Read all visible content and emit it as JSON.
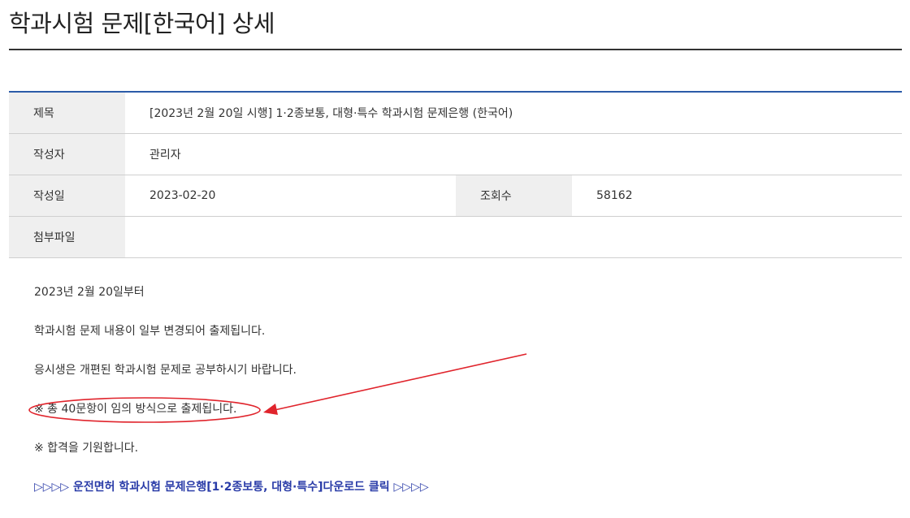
{
  "page": {
    "title": "학과시험 문제[한국어] 상세"
  },
  "info": {
    "subject_label": "제목",
    "subject_value": "[2023년 2월 20일 시행] 1·2종보통, 대형·특수 학과시험 문제은행 (한국어)",
    "author_label": "작성자",
    "author_value": "관리자",
    "date_label": "작성일",
    "date_value": "2023-02-20",
    "views_label": "조회수",
    "views_value": "58162",
    "attachment_label": "첨부파일",
    "attachment_value": ""
  },
  "content": {
    "lines": [
      "2023년 2월 20일부터",
      "학과시험 문제 내용이 일부 변경되어 출제됩니다.",
      "응시생은 개편된 학과시험 문제로 공부하시기 바랍니다.",
      "※ 총 40문항이 임의 방식으로 출제됩니다.",
      "※ 합격을 기원합니다."
    ],
    "download_link": "▷▷▷▷ 운전면허 학과시험 문제은행[1·2종보통, 대형·특수]다운로드 클릭 ▷▷▷▷"
  },
  "colors": {
    "header_border": "#2b5ba8",
    "label_bg": "#efefef",
    "link": "#2a3ca8",
    "annotation": "#e0242c"
  },
  "annotation": {
    "type": "red-ellipse-with-arrow",
    "target": "content.lines.3"
  }
}
